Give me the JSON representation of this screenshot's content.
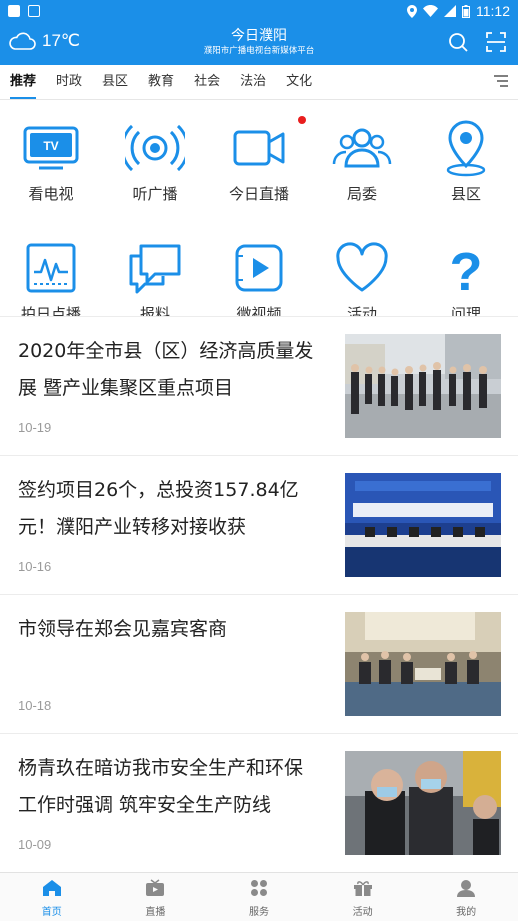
{
  "status_bar": {
    "time": "11:12"
  },
  "header": {
    "temperature": "17℃",
    "title": "今日濮阳",
    "subtitle": "濮阳市广播电视台新媒体平台"
  },
  "tabs": [
    {
      "label": "推荐",
      "active": true
    },
    {
      "label": "时政"
    },
    {
      "label": "县区"
    },
    {
      "label": "教育"
    },
    {
      "label": "社会"
    },
    {
      "label": "法治"
    },
    {
      "label": "文化"
    }
  ],
  "grid": {
    "row1": [
      {
        "label": "看电视",
        "icon": "tv-icon"
      },
      {
        "label": "听广播",
        "icon": "radio-broadcast-icon"
      },
      {
        "label": "今日直播",
        "icon": "video-camera-icon",
        "badge": true
      },
      {
        "label": "局委",
        "icon": "people-group-icon"
      },
      {
        "label": "县区",
        "icon": "location-pin-icon"
      }
    ],
    "row2": [
      {
        "label": "拍日点播",
        "icon": "waveform-icon"
      },
      {
        "label": "报料",
        "icon": "chat-bubbles-icon"
      },
      {
        "label": "微视频",
        "icon": "play-video-icon"
      },
      {
        "label": "活动",
        "icon": "heart-icon"
      },
      {
        "label": "问理",
        "icon": "question-mark-icon"
      }
    ]
  },
  "news": [
    {
      "title": "2020年全市县（区）经济高质量发展 暨产业集聚区重点项目",
      "date": "10-19"
    },
    {
      "title": "签约项目26个，总投资157.84亿元！濮阳产业转移对接收获",
      "date": "10-16"
    },
    {
      "title": "市领导在郑会见嘉宾客商",
      "date": "10-18"
    },
    {
      "title": "杨青玖在暗访我市安全生产和环保工作时强调 筑牢安全生产防线",
      "date": "10-09"
    }
  ],
  "bottom_nav": [
    {
      "label": "首页",
      "icon": "home-icon",
      "active": true
    },
    {
      "label": "直播",
      "icon": "live-tv-icon"
    },
    {
      "label": "服务",
      "icon": "services-icon"
    },
    {
      "label": "活动",
      "icon": "gift-icon"
    },
    {
      "label": "我的",
      "icon": "user-icon"
    }
  ],
  "colors": {
    "brand": "#1b8fe8",
    "badge": "#e91e1e"
  }
}
